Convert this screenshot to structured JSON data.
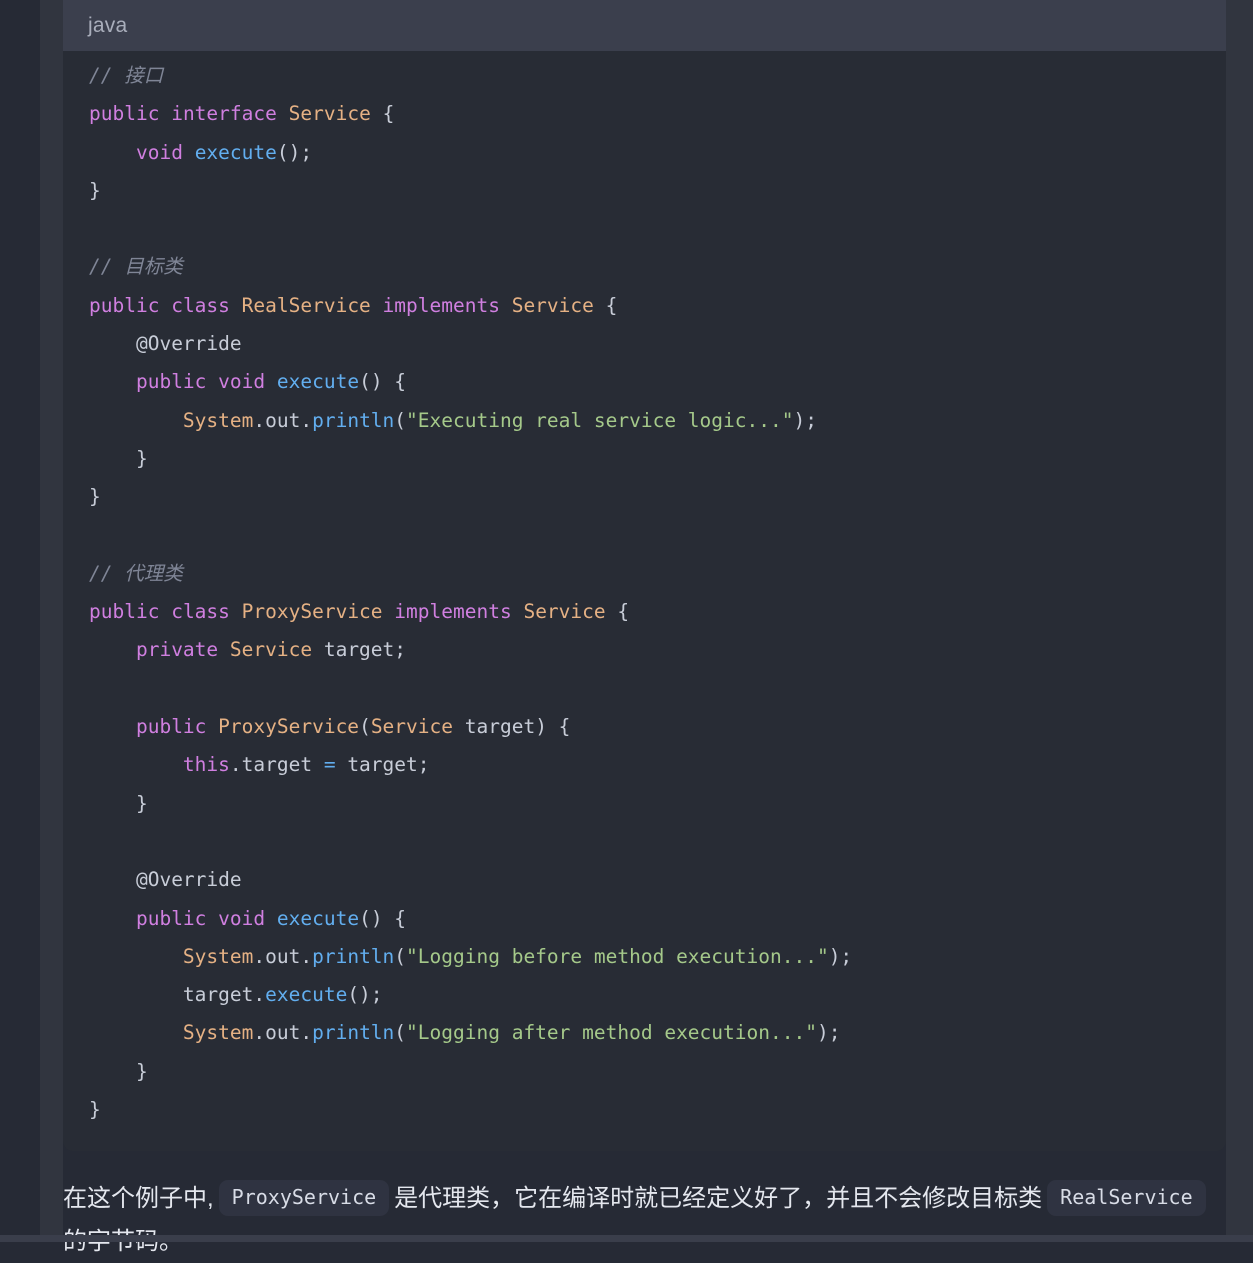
{
  "code_block": {
    "language_label": "java",
    "lines": [
      {
        "indent": 0,
        "tokens": [
          {
            "t": "comment",
            "v": "// 接口"
          }
        ]
      },
      {
        "indent": 0,
        "tokens": [
          {
            "t": "kw",
            "v": "public"
          },
          {
            "t": "plain",
            "v": " "
          },
          {
            "t": "kw",
            "v": "interface"
          },
          {
            "t": "plain",
            "v": " "
          },
          {
            "t": "type",
            "v": "Service"
          },
          {
            "t": "plain",
            "v": " "
          },
          {
            "t": "punc",
            "v": "{"
          }
        ]
      },
      {
        "indent": 1,
        "tokens": [
          {
            "t": "kw",
            "v": "void"
          },
          {
            "t": "plain",
            "v": " "
          },
          {
            "t": "fn",
            "v": "execute"
          },
          {
            "t": "punc",
            "v": "();"
          }
        ]
      },
      {
        "indent": 0,
        "tokens": [
          {
            "t": "punc",
            "v": "}"
          }
        ]
      },
      {
        "indent": 0,
        "tokens": []
      },
      {
        "indent": 0,
        "tokens": [
          {
            "t": "comment",
            "v": "// 目标类"
          }
        ]
      },
      {
        "indent": 0,
        "tokens": [
          {
            "t": "kw",
            "v": "public"
          },
          {
            "t": "plain",
            "v": " "
          },
          {
            "t": "kw",
            "v": "class"
          },
          {
            "t": "plain",
            "v": " "
          },
          {
            "t": "type",
            "v": "RealService"
          },
          {
            "t": "plain",
            "v": " "
          },
          {
            "t": "kw",
            "v": "implements"
          },
          {
            "t": "plain",
            "v": " "
          },
          {
            "t": "type",
            "v": "Service"
          },
          {
            "t": "plain",
            "v": " "
          },
          {
            "t": "punc",
            "v": "{"
          }
        ]
      },
      {
        "indent": 1,
        "tokens": [
          {
            "t": "ann",
            "v": "@Override"
          }
        ]
      },
      {
        "indent": 1,
        "tokens": [
          {
            "t": "kw",
            "v": "public"
          },
          {
            "t": "plain",
            "v": " "
          },
          {
            "t": "kw",
            "v": "void"
          },
          {
            "t": "plain",
            "v": " "
          },
          {
            "t": "fn",
            "v": "execute"
          },
          {
            "t": "punc",
            "v": "() {"
          }
        ]
      },
      {
        "indent": 2,
        "tokens": [
          {
            "t": "type",
            "v": "System"
          },
          {
            "t": "punc",
            "v": "."
          },
          {
            "t": "plain",
            "v": "out"
          },
          {
            "t": "punc",
            "v": "."
          },
          {
            "t": "fn",
            "v": "println"
          },
          {
            "t": "punc",
            "v": "("
          },
          {
            "t": "str",
            "v": "\"Executing real service logic...\""
          },
          {
            "t": "punc",
            "v": ");"
          }
        ]
      },
      {
        "indent": 1,
        "tokens": [
          {
            "t": "punc",
            "v": "}"
          }
        ]
      },
      {
        "indent": 0,
        "tokens": [
          {
            "t": "punc",
            "v": "}"
          }
        ]
      },
      {
        "indent": 0,
        "tokens": []
      },
      {
        "indent": 0,
        "tokens": [
          {
            "t": "comment",
            "v": "// 代理类"
          }
        ]
      },
      {
        "indent": 0,
        "tokens": [
          {
            "t": "kw",
            "v": "public"
          },
          {
            "t": "plain",
            "v": " "
          },
          {
            "t": "kw",
            "v": "class"
          },
          {
            "t": "plain",
            "v": " "
          },
          {
            "t": "type",
            "v": "ProxyService"
          },
          {
            "t": "plain",
            "v": " "
          },
          {
            "t": "kw",
            "v": "implements"
          },
          {
            "t": "plain",
            "v": " "
          },
          {
            "t": "type",
            "v": "Service"
          },
          {
            "t": "plain",
            "v": " "
          },
          {
            "t": "punc",
            "v": "{"
          }
        ]
      },
      {
        "indent": 1,
        "tokens": [
          {
            "t": "kw",
            "v": "private"
          },
          {
            "t": "plain",
            "v": " "
          },
          {
            "t": "type",
            "v": "Service"
          },
          {
            "t": "plain",
            "v": " target"
          },
          {
            "t": "punc",
            "v": ";"
          }
        ]
      },
      {
        "indent": 0,
        "tokens": []
      },
      {
        "indent": 1,
        "tokens": [
          {
            "t": "kw",
            "v": "public"
          },
          {
            "t": "plain",
            "v": " "
          },
          {
            "t": "type",
            "v": "ProxyService"
          },
          {
            "t": "punc",
            "v": "("
          },
          {
            "t": "type",
            "v": "Service"
          },
          {
            "t": "plain",
            "v": " target"
          },
          {
            "t": "punc",
            "v": ") {"
          }
        ]
      },
      {
        "indent": 2,
        "tokens": [
          {
            "t": "kw",
            "v": "this"
          },
          {
            "t": "punc",
            "v": "."
          },
          {
            "t": "plain",
            "v": "target "
          },
          {
            "t": "op",
            "v": "="
          },
          {
            "t": "plain",
            "v": " target"
          },
          {
            "t": "punc",
            "v": ";"
          }
        ]
      },
      {
        "indent": 1,
        "tokens": [
          {
            "t": "punc",
            "v": "}"
          }
        ]
      },
      {
        "indent": 0,
        "tokens": []
      },
      {
        "indent": 1,
        "tokens": [
          {
            "t": "ann",
            "v": "@Override"
          }
        ]
      },
      {
        "indent": 1,
        "tokens": [
          {
            "t": "kw",
            "v": "public"
          },
          {
            "t": "plain",
            "v": " "
          },
          {
            "t": "kw",
            "v": "void"
          },
          {
            "t": "plain",
            "v": " "
          },
          {
            "t": "fn",
            "v": "execute"
          },
          {
            "t": "punc",
            "v": "() {"
          }
        ]
      },
      {
        "indent": 2,
        "tokens": [
          {
            "t": "type",
            "v": "System"
          },
          {
            "t": "punc",
            "v": "."
          },
          {
            "t": "plain",
            "v": "out"
          },
          {
            "t": "punc",
            "v": "."
          },
          {
            "t": "fn",
            "v": "println"
          },
          {
            "t": "punc",
            "v": "("
          },
          {
            "t": "str",
            "v": "\"Logging before method execution...\""
          },
          {
            "t": "punc",
            "v": ");"
          }
        ]
      },
      {
        "indent": 2,
        "tokens": [
          {
            "t": "plain",
            "v": "target"
          },
          {
            "t": "punc",
            "v": "."
          },
          {
            "t": "fn",
            "v": "execute"
          },
          {
            "t": "punc",
            "v": "();"
          }
        ]
      },
      {
        "indent": 2,
        "tokens": [
          {
            "t": "type",
            "v": "System"
          },
          {
            "t": "punc",
            "v": "."
          },
          {
            "t": "plain",
            "v": "out"
          },
          {
            "t": "punc",
            "v": "."
          },
          {
            "t": "fn",
            "v": "println"
          },
          {
            "t": "punc",
            "v": "("
          },
          {
            "t": "str",
            "v": "\"Logging after method execution...\""
          },
          {
            "t": "punc",
            "v": ");"
          }
        ]
      },
      {
        "indent": 1,
        "tokens": [
          {
            "t": "punc",
            "v": "}"
          }
        ]
      },
      {
        "indent": 0,
        "tokens": [
          {
            "t": "punc",
            "v": "}"
          }
        ]
      }
    ]
  },
  "prose": {
    "segments": [
      {
        "type": "text",
        "v": "在这个例子中,"
      },
      {
        "type": "code",
        "v": "ProxyService"
      },
      {
        "type": "text",
        "v": "是代理类，它在编译时就已经定义好了，并且不会修改目标类"
      },
      {
        "type": "code",
        "v": "RealService"
      },
      {
        "type": "text",
        "v": "的字节码。"
      }
    ]
  },
  "colors": {
    "page_background": "#262a35",
    "gutter_band": "#31353f",
    "code_background": "#282c35",
    "code_header_background": "#3b3f4d",
    "keyword": "#d07fe0",
    "type": "#e5b184",
    "function": "#62aeef",
    "string": "#a5c98a",
    "comment": "#7f8596",
    "plain_text": "#c8cdd8",
    "prose_text": "#e4e7ee",
    "chip_background": "#2f3341"
  }
}
